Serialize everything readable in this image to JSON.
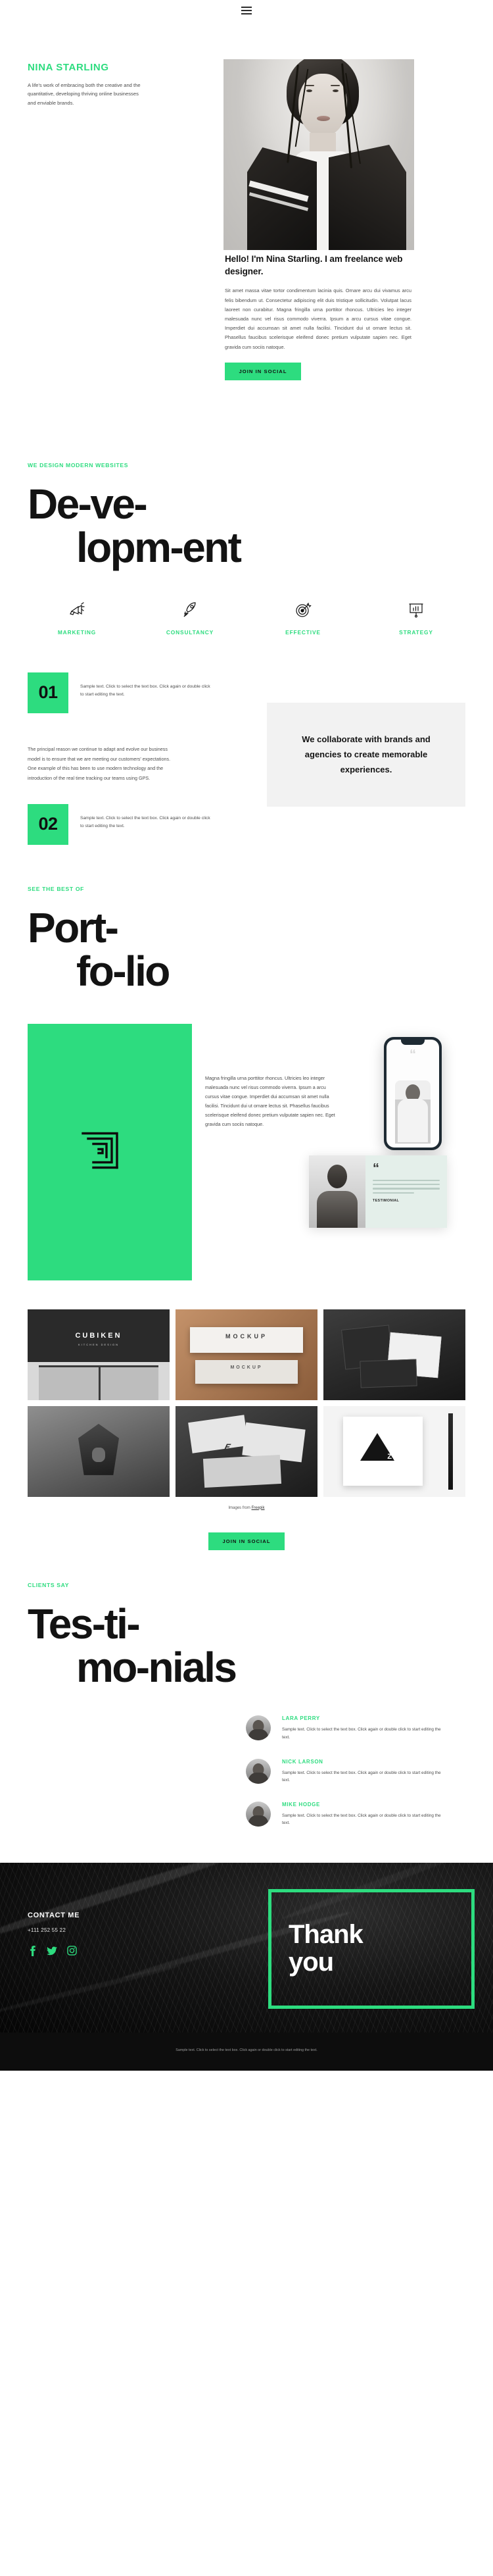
{
  "topbar": {
    "menu_icon": "hamburger-menu-icon"
  },
  "hero": {
    "brand": "NINA STARLING",
    "brand_sub": "A life's work of embracing both the creative and the quantitative, developing thriving online businesses and enviable brands.",
    "photo_alt": "portrait-photo",
    "title": "Hello! I'm Nina Starling. I am freelance web designer.",
    "body": "Sit amet massa vitae tortor condimentum lacinia quis. Ornare arcu dui vivamus arcu felis bibendum ut. Consectetur adipiscing elit duis tristique sollicitudin. Volutpat lacus laoreet non curabitur. Magna fringilla urna porttitor rhoncus. Ultricies leo integer malesuada nunc vel risus commodo viverra. Ipsum a arcu cursus vitae congue. Imperdiet dui accumsan sit amet nulla facilisi. Tincidunt dui ut ornare lectus sit. Phasellus faucibus scelerisque eleifend donec pretium vulputate sapien nec. Eget gravida cum sociis natoque.",
    "cta": "JOIN IN SOCIAL"
  },
  "development": {
    "label": "WE DESIGN MODERN WEBSITES",
    "title_line1": "De-ve-",
    "title_line2": "lopm-ent",
    "features": [
      {
        "name": "MARKETING",
        "icon": "megaphone-icon"
      },
      {
        "name": "CONSULTANCY",
        "icon": "rocket-icon"
      },
      {
        "name": "EFFECTIVE",
        "icon": "target-dart-icon"
      },
      {
        "name": "STRATEGY",
        "icon": "presentation-chart-icon"
      }
    ],
    "steps": [
      {
        "num": "01",
        "text": "Sample text. Click to select the text box. Click again or double click to start editing the text."
      },
      {
        "num": "02",
        "text": "Sample text. Click to select the text box. Click again or double click to start editing the text."
      }
    ],
    "paragraph": "The principal reason we continue to adapt and evolve our business model is to ensure that we are meeting our customers' expectations. One example of this has been to use modern technology and the introduction of the real time tracking our teams using GPS.",
    "collab_quote": "We collaborate with brands and agencies to create memorable experiences."
  },
  "portfolio": {
    "label": "SEE THE BEST OF",
    "title_line1": "Port-",
    "title_line2": "fo-lio",
    "logo_icon": "maze-logo-icon",
    "body": "Magna fringilla urna porttitor rhoncus. Ultricies leo integer malesuada nunc vel risus commodo viverra. Ipsum a arcu cursus vitae congue. Imperdiet dui accumsan sit amet nulla facilisi. Tincidunt dui ut ornare lectus sit. Phasellus faucibus scelerisque eleifend donec pretium vulputate sapien nec. Eget gravida cum sociis natoque.",
    "phone_alt": "phone-mockup",
    "quote_card": {
      "mark": "“",
      "name": "TESTIMONIAL"
    },
    "gallery": [
      {
        "name": "storefront-cubiken",
        "title": "CUBIKEN",
        "subtitle": "KITCHEN DESIGN"
      },
      {
        "name": "business-card-mockup",
        "title": "MOCKUP",
        "subtitle": "MOCKUP"
      },
      {
        "name": "dark-stationery-set",
        "title": "",
        "subtitle": ""
      },
      {
        "name": "lion-sculpture",
        "title": "",
        "subtitle": ""
      },
      {
        "name": "branding-papers",
        "title": "",
        "subtitle": ""
      },
      {
        "name": "poster-triangle-z",
        "title": "Z",
        "subtitle": ""
      }
    ],
    "credit_prefix": "Images from ",
    "credit_link": "Freepik",
    "cta": "JOIN IN SOCIAL"
  },
  "testimonials": {
    "label": "CLIENTS SAY",
    "title_line1": "Tes-ti-",
    "title_line2": "mo-nials",
    "items": [
      {
        "name": "LARA PERRY",
        "text": "Sample text. Click to select the text box. Click again or double click to start editing the text."
      },
      {
        "name": "NICK LARSON",
        "text": "Sample text. Click to select the text box. Click again or double click to start editing the text."
      },
      {
        "name": "MIKE HODGE",
        "text": "Sample text. Click to select the text box. Click again or double click to start editing the text."
      }
    ]
  },
  "footer": {
    "contact_title": "CONTACT ME",
    "phone": "+111 252 55 22",
    "socials": [
      {
        "name": "facebook-icon",
        "glyph": "f"
      },
      {
        "name": "twitter-icon",
        "glyph": "t"
      },
      {
        "name": "instagram-icon",
        "glyph": "i"
      }
    ],
    "thanks_line1": "Thank",
    "thanks_line2": "you",
    "bottom_text": "Sample text. Click to select the text box. Click again or double click to start editing the text."
  },
  "colors": {
    "accent": "#2ddc7f",
    "dark": "#131313",
    "muted": "#4e4e4e"
  }
}
